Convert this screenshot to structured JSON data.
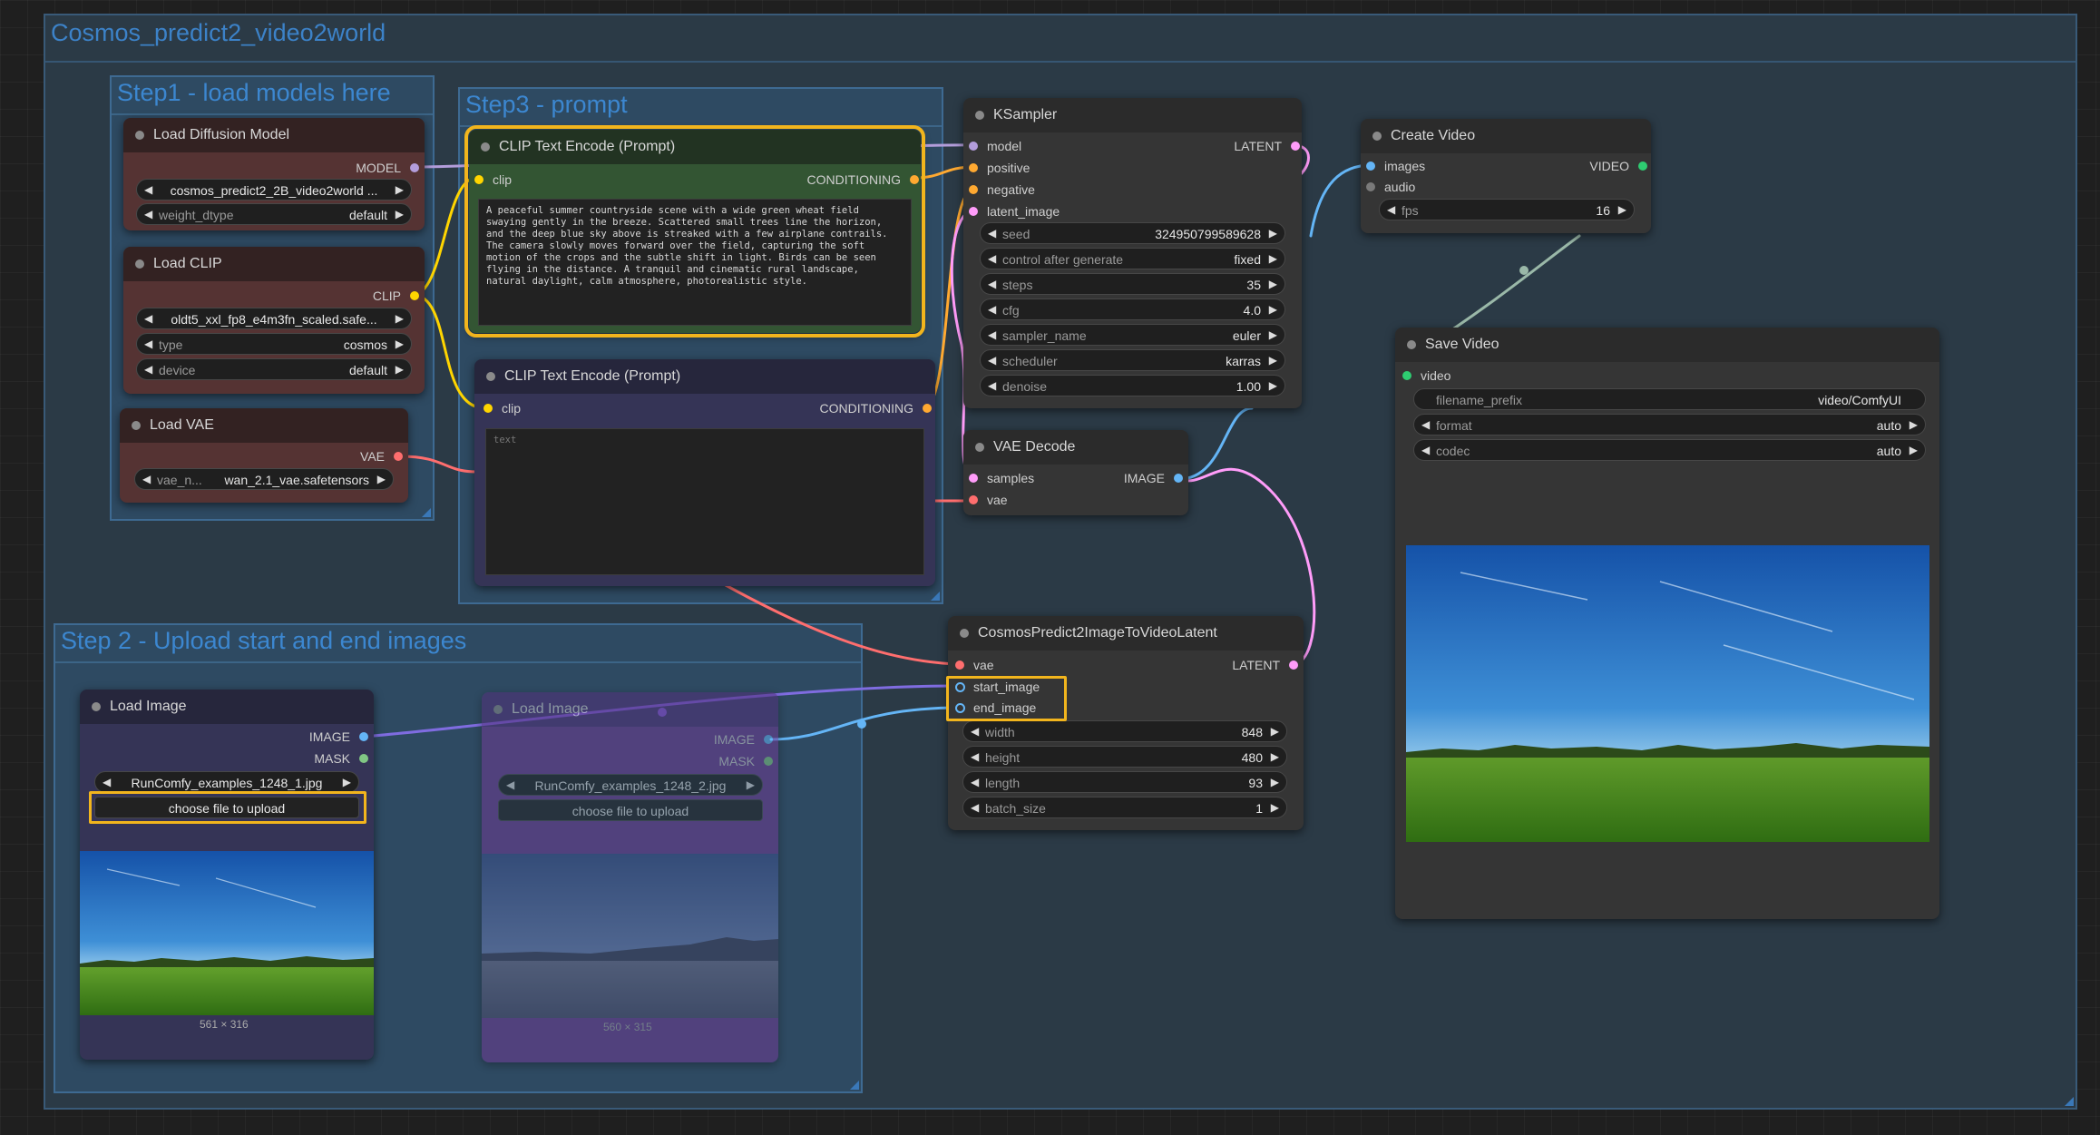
{
  "workflow_title": "Cosmos_predict2_video2world",
  "groups": {
    "step1": "Step1 - load models here",
    "step2": "Step 2 - Upload start and end images",
    "step3": "Step3 - prompt"
  },
  "nodes": {
    "load_diffusion": {
      "title": "Load Diffusion Model",
      "out_model": "MODEL",
      "unet_name": "cosmos_predict2_2B_video2world ...",
      "weight_dtype_label": "weight_dtype",
      "weight_dtype_value": "default"
    },
    "load_clip": {
      "title": "Load CLIP",
      "out_clip": "CLIP",
      "clip_name": "oldt5_xxl_fp8_e4m3fn_scaled.safe...",
      "type_label": "type",
      "type_value": "cosmos",
      "device_label": "device",
      "device_value": "default"
    },
    "load_vae": {
      "title": "Load VAE",
      "out_vae": "VAE",
      "vae_label": "vae_n...",
      "vae_value": "wan_2.1_vae.safetensors"
    },
    "clip_pos": {
      "title": "CLIP Text Encode (Prompt)",
      "in_clip": "clip",
      "out_cond": "CONDITIONING",
      "text": "A peaceful summer countryside scene with a wide green wheat field swaying gently in the breeze. Scattered small trees line the horizon, and the deep blue sky above is streaked with a few airplane contrails. The camera slowly moves forward over the field, capturing the soft motion of the crops and the subtle shift in light. Birds can be seen flying in the distance. A tranquil and cinematic rural landscape, natural daylight, calm atmosphere, photorealistic style."
    },
    "clip_neg": {
      "title": "CLIP Text Encode (Prompt)",
      "in_clip": "clip",
      "out_cond": "CONDITIONING",
      "placeholder": "text"
    },
    "ksampler": {
      "title": "KSampler",
      "in_model": "model",
      "in_positive": "positive",
      "in_negative": "negative",
      "in_latent": "latent_image",
      "out_latent": "LATENT",
      "widgets": [
        {
          "label": "seed",
          "value": "324950799589628"
        },
        {
          "label": "control after generate",
          "value": "fixed"
        },
        {
          "label": "steps",
          "value": "35"
        },
        {
          "label": "cfg",
          "value": "4.0"
        },
        {
          "label": "sampler_name",
          "value": "euler"
        },
        {
          "label": "scheduler",
          "value": "karras"
        },
        {
          "label": "denoise",
          "value": "1.00"
        }
      ]
    },
    "vae_decode": {
      "title": "VAE Decode",
      "in_samples": "samples",
      "in_vae": "vae",
      "out_image": "IMAGE"
    },
    "create_video": {
      "title": "Create Video",
      "in_images": "images",
      "in_audio": "audio",
      "out_video": "VIDEO",
      "fps_label": "fps",
      "fps_value": "16"
    },
    "save_video": {
      "title": "Save Video",
      "in_video": "video",
      "widgets": [
        {
          "label": "filename_prefix",
          "value": "video/ComfyUI"
        },
        {
          "label": "format",
          "value": "auto"
        },
        {
          "label": "codec",
          "value": "auto"
        }
      ]
    },
    "cosmos_latent": {
      "title": "CosmosPredict2ImageToVideoLatent",
      "in_vae": "vae",
      "in_start": "start_image",
      "in_end": "end_image",
      "out_latent": "LATENT",
      "widgets": [
        {
          "label": "width",
          "value": "848"
        },
        {
          "label": "height",
          "value": "480"
        },
        {
          "label": "length",
          "value": "93"
        },
        {
          "label": "batch_size",
          "value": "1"
        }
      ]
    },
    "load_image_1": {
      "title": "Load Image",
      "out_image": "IMAGE",
      "out_mask": "MASK",
      "filename": "RunComfy_examples_1248_1.jpg",
      "upload": "choose file to upload",
      "dims": "561 × 316"
    },
    "load_image_2": {
      "title": "Load Image",
      "out_image": "IMAGE",
      "out_mask": "MASK",
      "filename": "RunComfy_examples_1248_2.jpg",
      "upload": "choose file to upload",
      "dims": "560 × 315"
    }
  },
  "colors": {
    "model": "#b39ddb",
    "clip": "#ffd500",
    "vae": "#ff6e6e",
    "conditioning": "#ffa931",
    "latent": "#ff9cf9",
    "image": "#64b5f6",
    "highlight": "#f2b51d"
  }
}
